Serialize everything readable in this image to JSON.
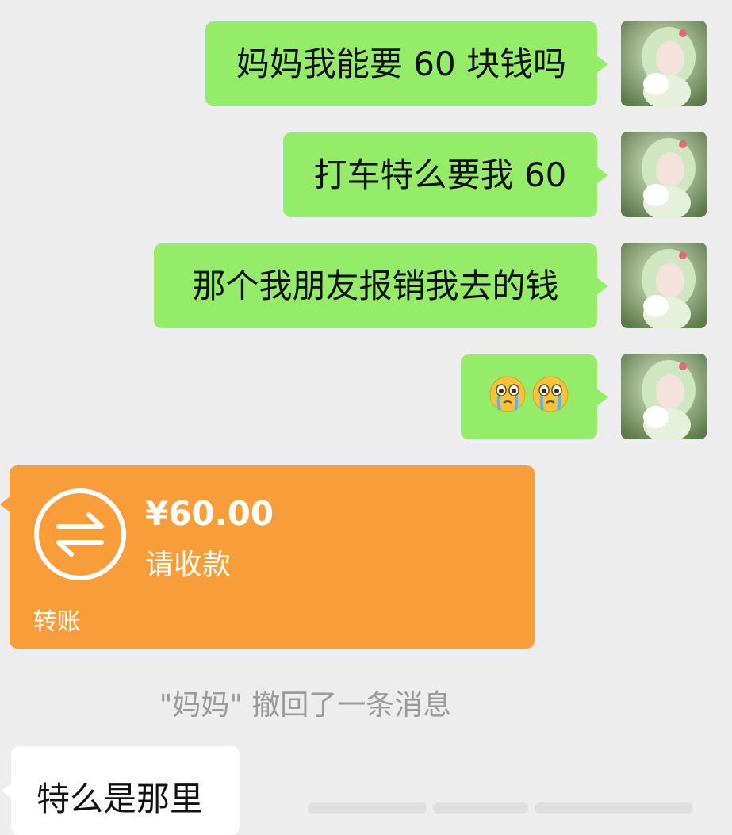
{
  "colors": {
    "background": "#ededed",
    "my_bubble": "#95ec69",
    "their_bubble": "#ffffff",
    "transfer_card": "#f99d3a",
    "system_text": "#9a9a9a"
  },
  "messages": [
    {
      "sender": "me",
      "text": "妈妈我能要 60 块钱吗"
    },
    {
      "sender": "me",
      "text": "打车特么要我 60"
    },
    {
      "sender": "me",
      "text": "那个我朋友报销我去的钱"
    },
    {
      "sender": "me",
      "emoji": [
        "crying-face-emoji",
        "crying-face-emoji"
      ]
    }
  ],
  "transfer": {
    "icon": "transfer-arrows-icon",
    "amount": "¥60.00",
    "status": "请收款",
    "label": "转账"
  },
  "system_message": "\"妈妈\" 撤回了一条消息",
  "reply": {
    "sender": "them",
    "text": "特么是那里"
  }
}
